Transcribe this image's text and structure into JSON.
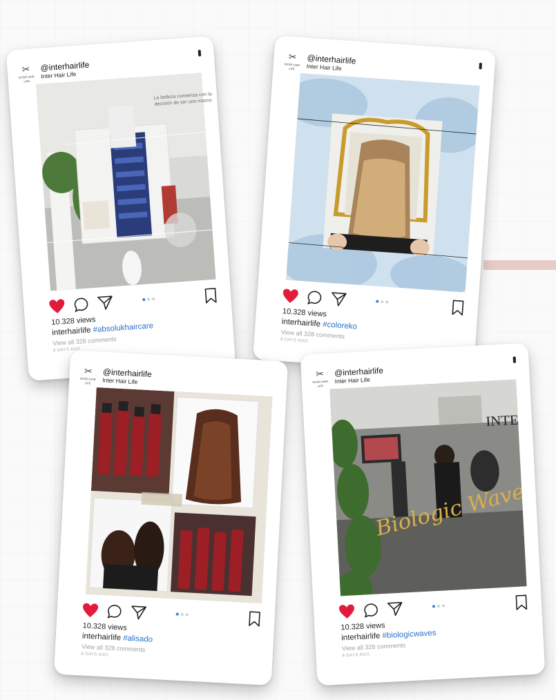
{
  "colors": {
    "like": "#e31b3b",
    "hashtag": "#2a6fc9",
    "dot_active": "#3d7bd8",
    "accent_bar": "#e3c2bc"
  },
  "posts": [
    {
      "handle": "@interhairlife",
      "name": "Inter Hair Life",
      "photo_text": "La belleza comienza con la decisión de ser uno mismo",
      "views": "10.328 views",
      "caption_user": "interhairlife",
      "hashtag": "#absolukhaircare",
      "comments": "View all 328 comments",
      "ago": "8 DAYS AGO"
    },
    {
      "handle": "@interhairlife",
      "name": "Inter Hair Life",
      "photo_text": "",
      "views": "10.328 views",
      "caption_user": "interhairlife",
      "hashtag": "#coloreko",
      "comments": "View all 328 comments",
      "ago": "8 DAYS AGO"
    },
    {
      "handle": "@interhairlife",
      "name": "Inter Hair Life",
      "photo_text": "",
      "views": "10.328 views",
      "caption_user": "interhairlife",
      "hashtag": "#alisado",
      "comments": "View all 328 comments",
      "ago": "8 DAYS AGO"
    },
    {
      "handle": "@interhairlife",
      "name": "Inter Hair Life",
      "photo_text": "Biologic Waves",
      "wall_text": "INTER",
      "views": "10.328 views",
      "caption_user": "interhairlife",
      "hashtag": "#biologicwaves",
      "comments": "View all 328 comments",
      "ago": "8 DAYS AGO"
    }
  ],
  "icons": [
    "heart-icon",
    "comment-icon",
    "share-icon",
    "bookmark-icon",
    "more-options-icon"
  ]
}
